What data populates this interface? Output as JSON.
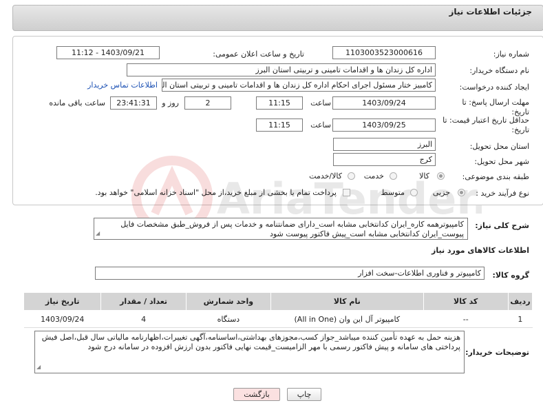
{
  "header": {
    "title": "جزئیات اطلاعات نیاز"
  },
  "fields": {
    "need_number_label": "شماره نیاز:",
    "need_number": "1103003523000616",
    "announce_label": "تاریخ و ساعت اعلان عمومی:",
    "announce_value": "1403/09/21 - 11:12",
    "buyer_label": "نام دستگاه خریدار:",
    "buyer_value": "اداره کل زندان ها و اقدامات تامینی و تربیتی استان البرز",
    "creator_label": "ایجاد کننده درخواست:",
    "creator_value": "کامبیز ختار مسئول اجرای احکام اداره کل زندان ها و اقدامات تامینی و تربیتی استان البرز",
    "contact_link": "اطلاعات تماس خریدار",
    "reply_deadline_label_1": "مهلت ارسال پاسخ: تا",
    "reply_deadline_label_2": "تاریخ:",
    "reply_date": "1403/09/24",
    "time_word": "ساعت",
    "reply_time": "11:15",
    "days_value": "2",
    "days_word": "روز و",
    "remaining_time": "23:41:31",
    "remaining_word": "ساعت باقی مانده",
    "price_validity_label_1": "حداقل تاریخ اعتبار قیمت: تا",
    "price_validity_label_2": "تاریخ:",
    "price_date": "1403/09/25",
    "price_time": "11:15",
    "province_label": "استان محل تحویل:",
    "province_value": "البرز",
    "city_label": "شهر محل تحویل:",
    "city_value": "کرج",
    "category_label": "طبقه بندی موضوعی:",
    "category_options": [
      "کالا",
      "خدمت",
      "کالا/خدمت"
    ],
    "process_label": "نوع فرآیند خرید :",
    "process_options": [
      "جزیی",
      "متوسط"
    ],
    "payment_note": "پرداخت تمام یا بخشی از مبلغ خرید،از محل \"اسناد خزانه اسلامی\" خواهد بود."
  },
  "description": {
    "label": "شرح کلی نیاز:",
    "text": "کامپیوترهمه کاره_ایران کدانتخابی مشابه است_دارای ضمانتنامه و خدمات پس از فروش_طبق مشخصات فایل پیوست_ایران کدانتخابی مشابه است_پیش فاکتور پیوست شود"
  },
  "goods_section": {
    "title": "اطلاعات کالاهای مورد نیاز",
    "group_label": "گروه کالا:",
    "group_value": "کامپیوتر و فناوری اطلاعات-سخت افزار"
  },
  "table": {
    "headers": [
      "ردیف",
      "کد کالا",
      "نام کالا",
      "واحد شمارش",
      "تعداد / مقدار",
      "تاریخ نیاز"
    ],
    "rows": [
      [
        "1",
        "--",
        "کامپیوتر آل این وان (All in One)",
        "دستگاه",
        "4",
        "1403/09/24"
      ]
    ]
  },
  "buyer_notes": {
    "label": "توضیحات خریدار:",
    "text": "هزینه حمل به عهده تأمین کننده میباشد_جواز کسب،مجوزهای بهداشتی،اساسنامه،آگهی تغییرات،اظهارنامه مالیاتی سال قبل،اصل فیش پرداختی های سامانه و پیش فاکتور رسمی با مهر الزامیست_قیمت نهایی فاکتور بدون ارزش افزوده در سامانه درج شود"
  },
  "buttons": {
    "print": "چاپ",
    "back": "بازگشت"
  },
  "watermark": {
    "text": "AriaTender.neT"
  },
  "colors": {
    "link": "#1a4fb3",
    "back_button_bg": "#fbe1e1"
  }
}
